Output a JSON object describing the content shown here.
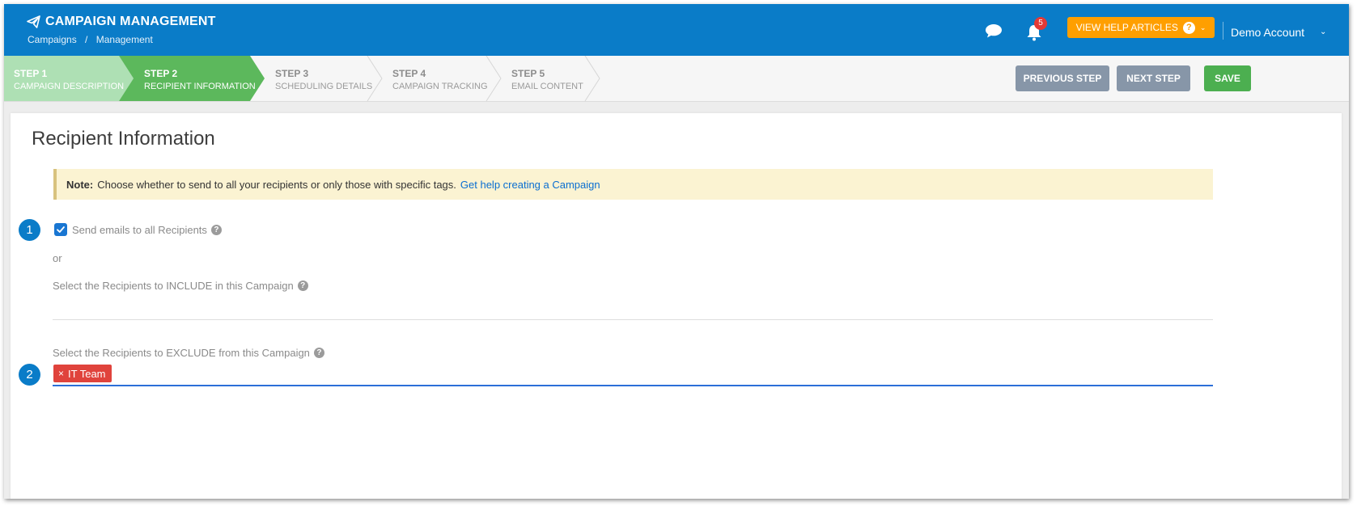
{
  "header": {
    "app_title": "CAMPAIGN MANAGEMENT",
    "breadcrumbs": [
      "Campaigns",
      "Management"
    ],
    "breadcrumb_separator": "/",
    "notification_count": "5",
    "help_button": "VIEW HELP ARTICLES",
    "help_icon": "?",
    "account": "Demo Account",
    "colors": {
      "bar": "#0a7cc8",
      "help": "#ff9f00",
      "badge": "#e53935"
    }
  },
  "steps": [
    {
      "label": "STEP 1",
      "sub": "CAMPAIGN DESCRIPTION",
      "state": "done"
    },
    {
      "label": "STEP 2",
      "sub": "RECIPIENT INFORMATION",
      "state": "active"
    },
    {
      "label": "STEP 3",
      "sub": "SCHEDULING DETAILS",
      "state": "pending"
    },
    {
      "label": "STEP 4",
      "sub": "CAMPAIGN TRACKING",
      "state": "pending"
    },
    {
      "label": "STEP 5",
      "sub": "EMAIL CONTENT",
      "state": "pending"
    }
  ],
  "step_colors": {
    "done": "#aee0b4",
    "active": "#5cb85c",
    "pending": "#f6f6f6"
  },
  "actions": {
    "previous": "PREVIOUS STEP",
    "next": "NEXT STEP",
    "save": "SAVE"
  },
  "main": {
    "title": "Recipient Information",
    "note": {
      "label": "Note:",
      "text": "Choose whether to send to all your recipients or only those with specific tags.",
      "link": "Get help creating a Campaign"
    },
    "markers": [
      "1",
      "2"
    ],
    "send_all": {
      "label": "Send emails to all Recipients",
      "checked": true
    },
    "or_text": "or",
    "include_label": "Select the Recipients to INCLUDE in this Campaign",
    "exclude_label": "Select the Recipients to EXCLUDE from this Campaign",
    "exclude_tags": [
      {
        "remove": "×",
        "label": "IT Team"
      }
    ],
    "help_icon": "?"
  }
}
